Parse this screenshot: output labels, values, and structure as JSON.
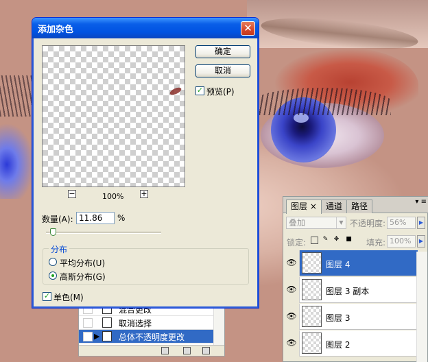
{
  "dialog": {
    "title": "添加杂色",
    "close_glyph": "✕",
    "ok_label": "确定",
    "cancel_label": "取消",
    "preview_label": "预览(P)",
    "preview_checked": true,
    "zoom_minus": "−",
    "zoom_plus": "+",
    "zoom_level": "100%",
    "amount_label": "数量(A):",
    "amount_value": "11.86",
    "amount_unit": "%",
    "amount_slider_fraction": 0.06,
    "distribution_title": "分布",
    "uniform_label": "平均分布(U)",
    "gaussian_label": "高斯分布(G)",
    "selected_distribution": "gaussian",
    "monochromatic_label": "单色(M)",
    "monochromatic_checked": true,
    "check_glyph": "✓"
  },
  "history": {
    "items": [
      {
        "label": "混合更改",
        "selected": false
      },
      {
        "label": "取消选择",
        "selected": false
      },
      {
        "label": "总体不透明度更改",
        "selected": true
      }
    ]
  },
  "layers": {
    "tabs": [
      {
        "label": "图层 ×",
        "active": true
      },
      {
        "label": "通道",
        "active": false
      },
      {
        "label": "路径",
        "active": false
      }
    ],
    "menu_glyph": "▾ ≡",
    "blend_mode": "叠加",
    "opacity_label": "不透明度:",
    "opacity_value": "56%",
    "lock_label": "锁定:",
    "fill_label": "填充:",
    "fill_value": "100%",
    "items": [
      {
        "name": "图层 4",
        "selected": true
      },
      {
        "name": "图层 3 副本",
        "selected": false
      },
      {
        "name": "图层 3",
        "selected": false
      },
      {
        "name": "图层 2",
        "selected": false
      }
    ]
  },
  "colors": {
    "title_bar": "#0a5fe8",
    "selection": "#316ac5",
    "dialog_bg": "#ece9d8",
    "accent_green": "#21a121"
  }
}
